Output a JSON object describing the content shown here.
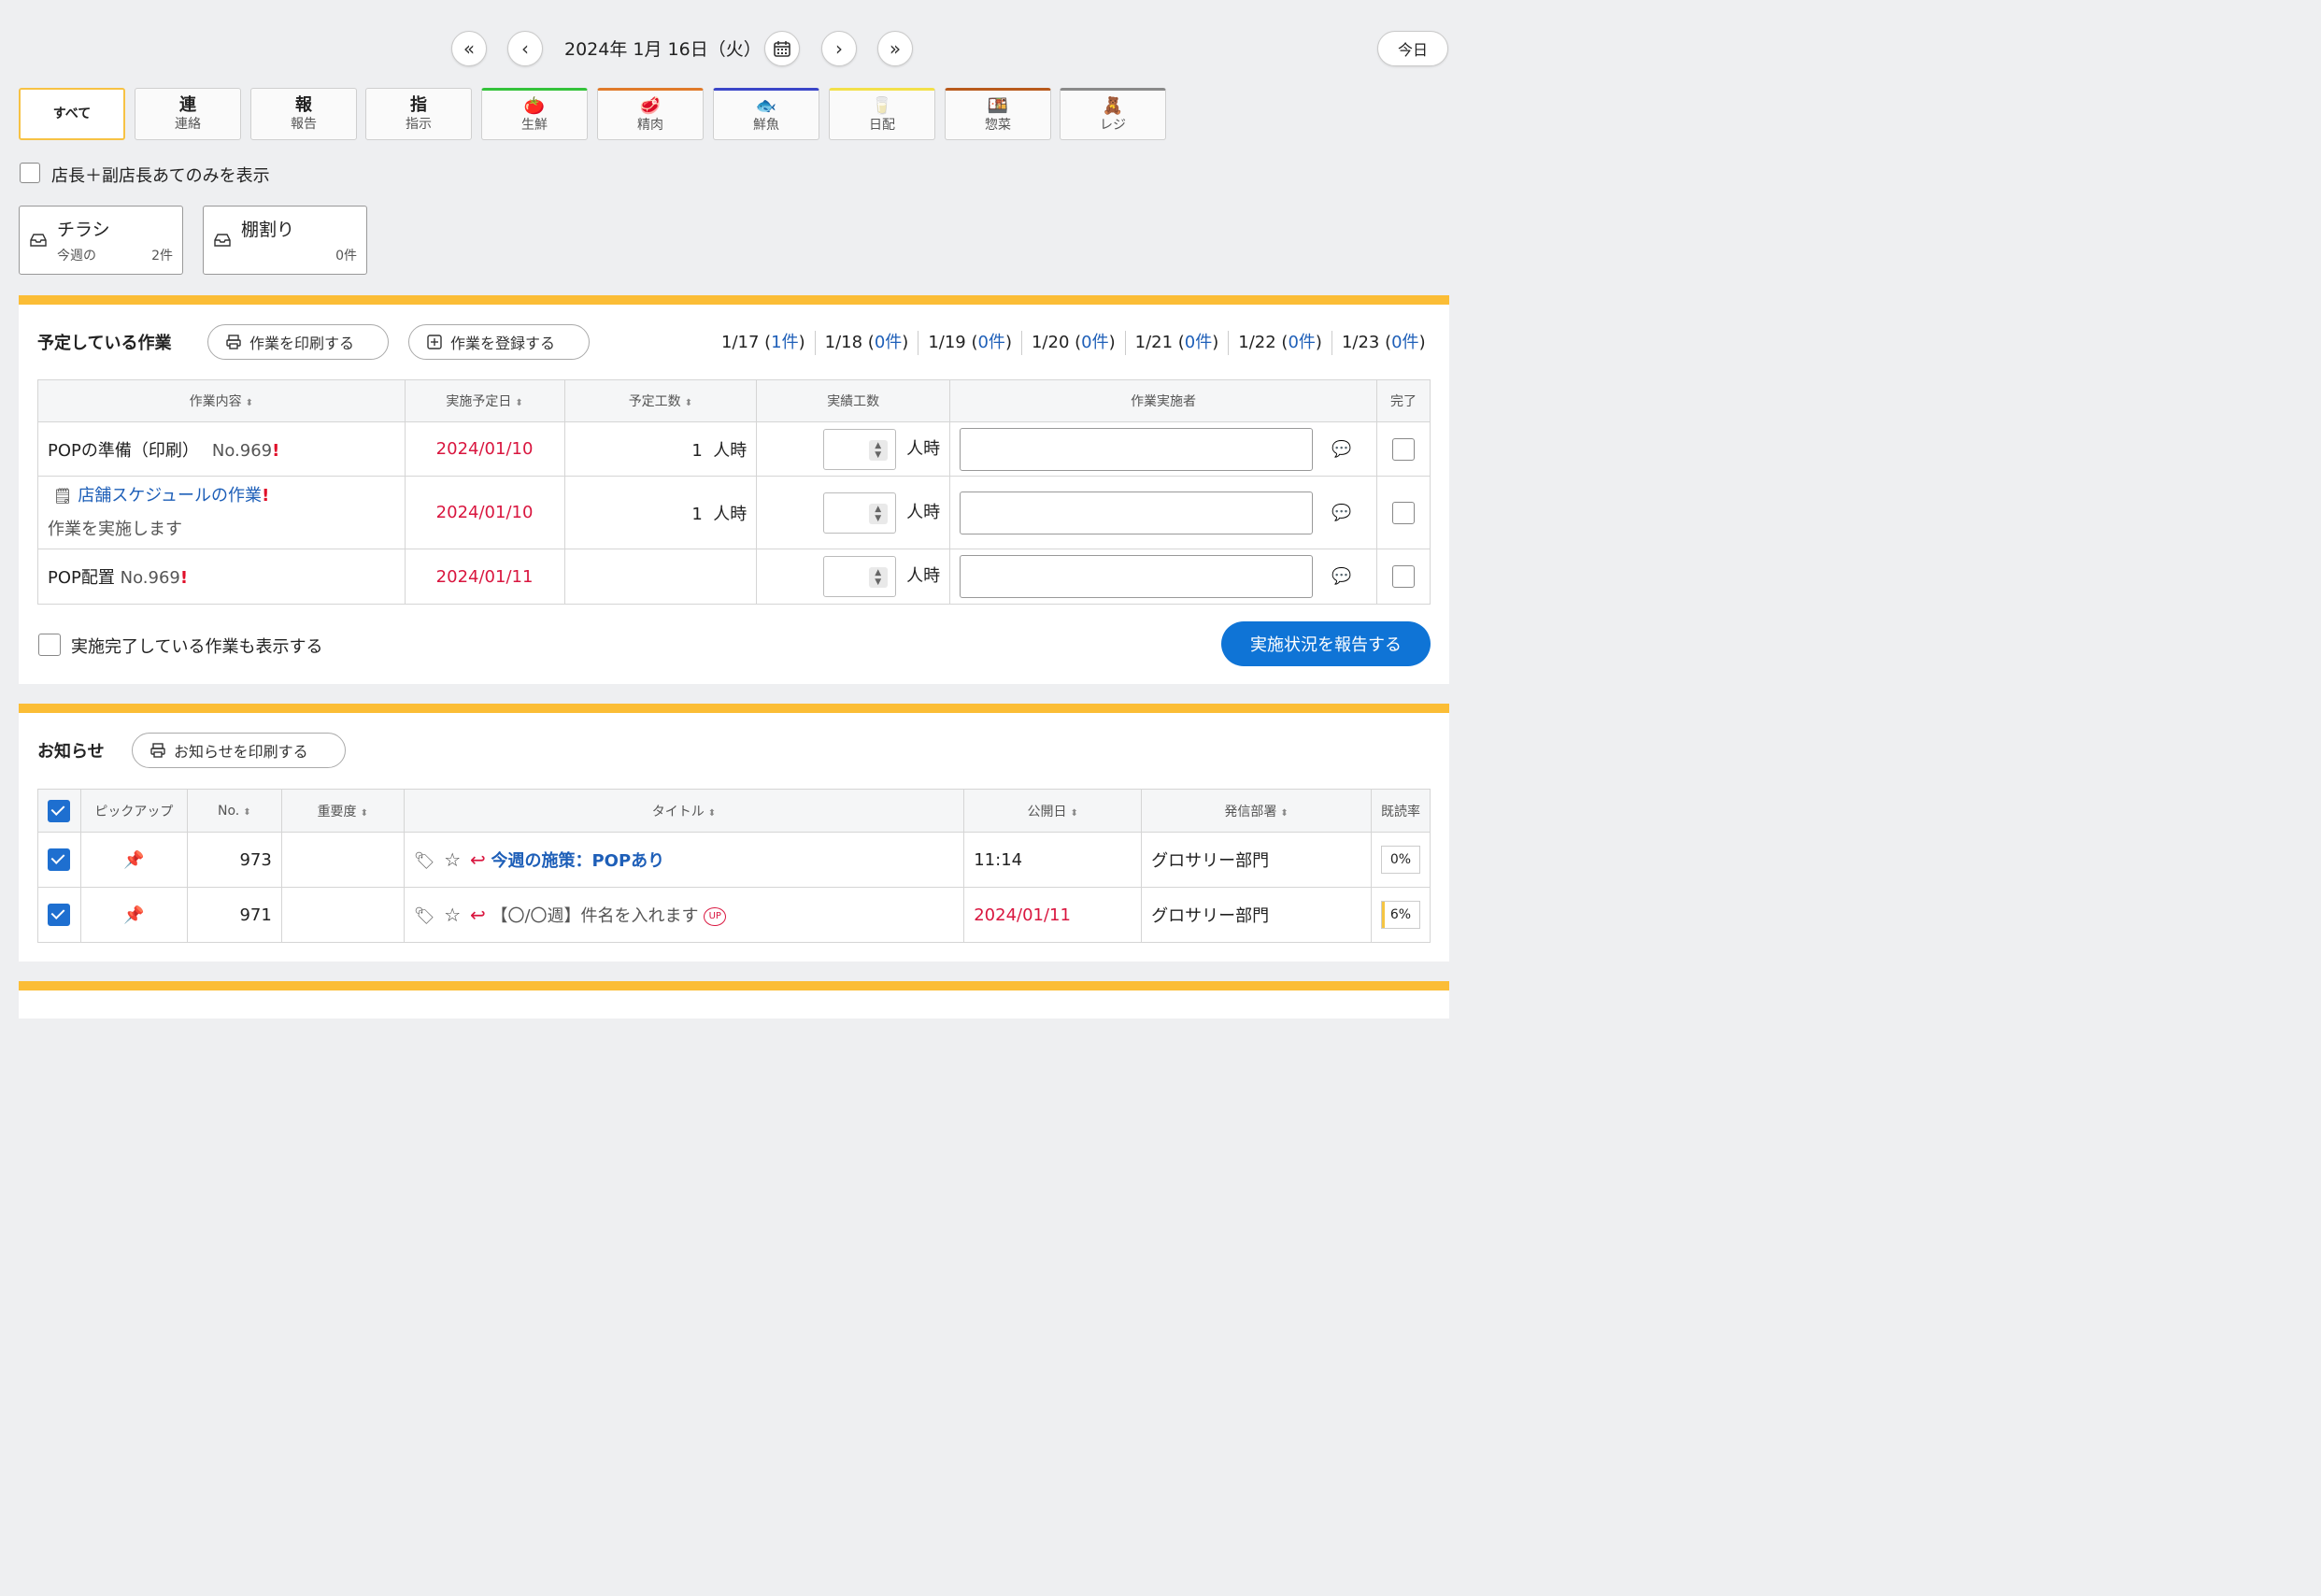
{
  "datenav": {
    "date_label": "2024年 1月 16日（火）",
    "today_label": "今日"
  },
  "categories": [
    {
      "big": "すべて",
      "small": ""
    },
    {
      "big": "連",
      "small": "連絡"
    },
    {
      "big": "報",
      "small": "報告"
    },
    {
      "big": "指",
      "small": "指示"
    },
    {
      "big": "",
      "small": "生鮮",
      "icon": "🍅",
      "color": "#34c23a"
    },
    {
      "big": "",
      "small": "精肉",
      "icon": "🥩",
      "color": "#e07a2a"
    },
    {
      "big": "",
      "small": "鮮魚",
      "icon": "🐟",
      "color": "#3a46c8"
    },
    {
      "big": "",
      "small": "日配",
      "icon": "🥛",
      "color": "#f2e04a"
    },
    {
      "big": "",
      "small": "惣菜",
      "icon": "🍱",
      "color": "#b85a1c"
    },
    {
      "big": "",
      "small": "レジ",
      "icon": "🧸",
      "color": "#8a8a8a"
    }
  ],
  "filter_label": "店長＋副店長あてのみを表示",
  "inboxes": [
    {
      "title": "チラシ",
      "sub": "今週の",
      "count": "2件"
    },
    {
      "title": "棚割り",
      "sub": "",
      "count": "0件"
    }
  ],
  "tasks": {
    "title": "予定している作業",
    "print_label": "作業を印刷する",
    "register_label": "作業を登録する",
    "days": [
      {
        "date": "1/17",
        "count": "1件"
      },
      {
        "date": "1/18",
        "count": "0件"
      },
      {
        "date": "1/19",
        "count": "0件"
      },
      {
        "date": "1/20",
        "count": "0件"
      },
      {
        "date": "1/21",
        "count": "0件"
      },
      {
        "date": "1/22",
        "count": "0件"
      },
      {
        "date": "1/23",
        "count": "0件"
      }
    ],
    "headers": [
      "作業内容",
      "実施予定日",
      "予定工数",
      "実績工数",
      "作業実施者",
      "完了"
    ],
    "rows": [
      {
        "name": "POPの準備（印刷）",
        "no": "No.969",
        "date": "2024/01/10",
        "plan": "1",
        "unit": "人時"
      },
      {
        "name": "店舗スケジュールの作業",
        "sub": "作業を実施します",
        "date": "2024/01/10",
        "plan": "1",
        "unit": "人時"
      },
      {
        "name": "POP配置",
        "no": "No.969",
        "date": "2024/01/11",
        "plan": "",
        "unit": "人時"
      }
    ],
    "plan_unit": "人時",
    "show_done_label": "実施完了している作業も表示する",
    "report_label": "実施状況を報告する"
  },
  "notices": {
    "title": "お知らせ",
    "print_label": "お知らせを印刷する",
    "headers": [
      "ピックアップ",
      "No.",
      "重要度",
      "タイトル",
      "公開日",
      "発信部署",
      "既読率"
    ],
    "rows": [
      {
        "no": "973",
        "title": "今週の施策：POPあり",
        "date": "11:14",
        "dept": "グロサリー部門",
        "rate": "0%",
        "read": 0,
        "up": ""
      },
      {
        "no": "971",
        "title": "【〇/〇週】件名を入れます",
        "date": "2024/01/11",
        "dept": "グロサリー部門",
        "rate": "6%",
        "read": 6,
        "up": "UP"
      }
    ]
  }
}
